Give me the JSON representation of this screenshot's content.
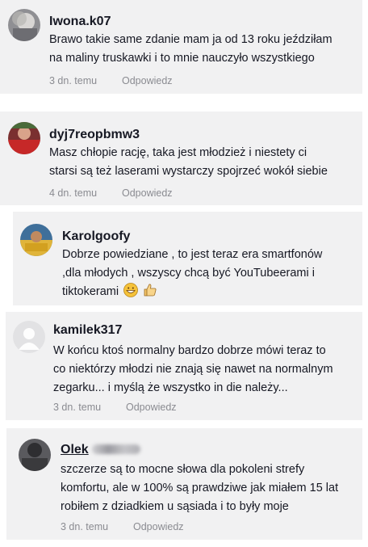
{
  "comments": [
    {
      "username": "Iwona.k07",
      "lines": [
        "Brawo takie same zdanie mam ja od 13 roku jeździłam",
        "na maliny truskawki i to mnie nauczyło wszystkiego"
      ],
      "time": "3 dn. temu",
      "reply": "Odpowiedz"
    },
    {
      "username": "dyj7reopbmw3",
      "lines": [
        "Masz chłopie rację, taka jest młodzież i niestety ci",
        "starsi są też laserami wystarczy spojrzeć wokół siebie"
      ],
      "time": "4 dn. temu",
      "reply": "Odpowiedz"
    },
    {
      "username": "Karolgoofy",
      "lines": [
        "Dobrze powiedziane , to jest teraz era smartfonów",
        ",dla młodych , wszyscy chcą być YouTubeerami i",
        "tiktokerami"
      ],
      "emojis": [
        "grinning-face-icon",
        "thumbs-up-icon"
      ]
    },
    {
      "username": "kamilek317",
      "lines": [
        "W końcu ktoś normalny bardzo dobrze mówi teraz to",
        "co niektórzy młodzi nie znają się nawet na normalnym",
        "zegarku... i myślą że wszystko in die należy..."
      ],
      "time": "3 dn. temu",
      "reply": "Odpowiedz"
    },
    {
      "username": "Olek",
      "lines": [
        "szczerze są to mocne słowa dla pokoleni strefy",
        "komfortu, ale w 100% są prawdziwe jak miałem 15 lat",
        "robiłem z dziadkiem u sąsiada i to były moje"
      ],
      "time": "3 dn. temu",
      "reply": "Odpowiedz"
    }
  ]
}
